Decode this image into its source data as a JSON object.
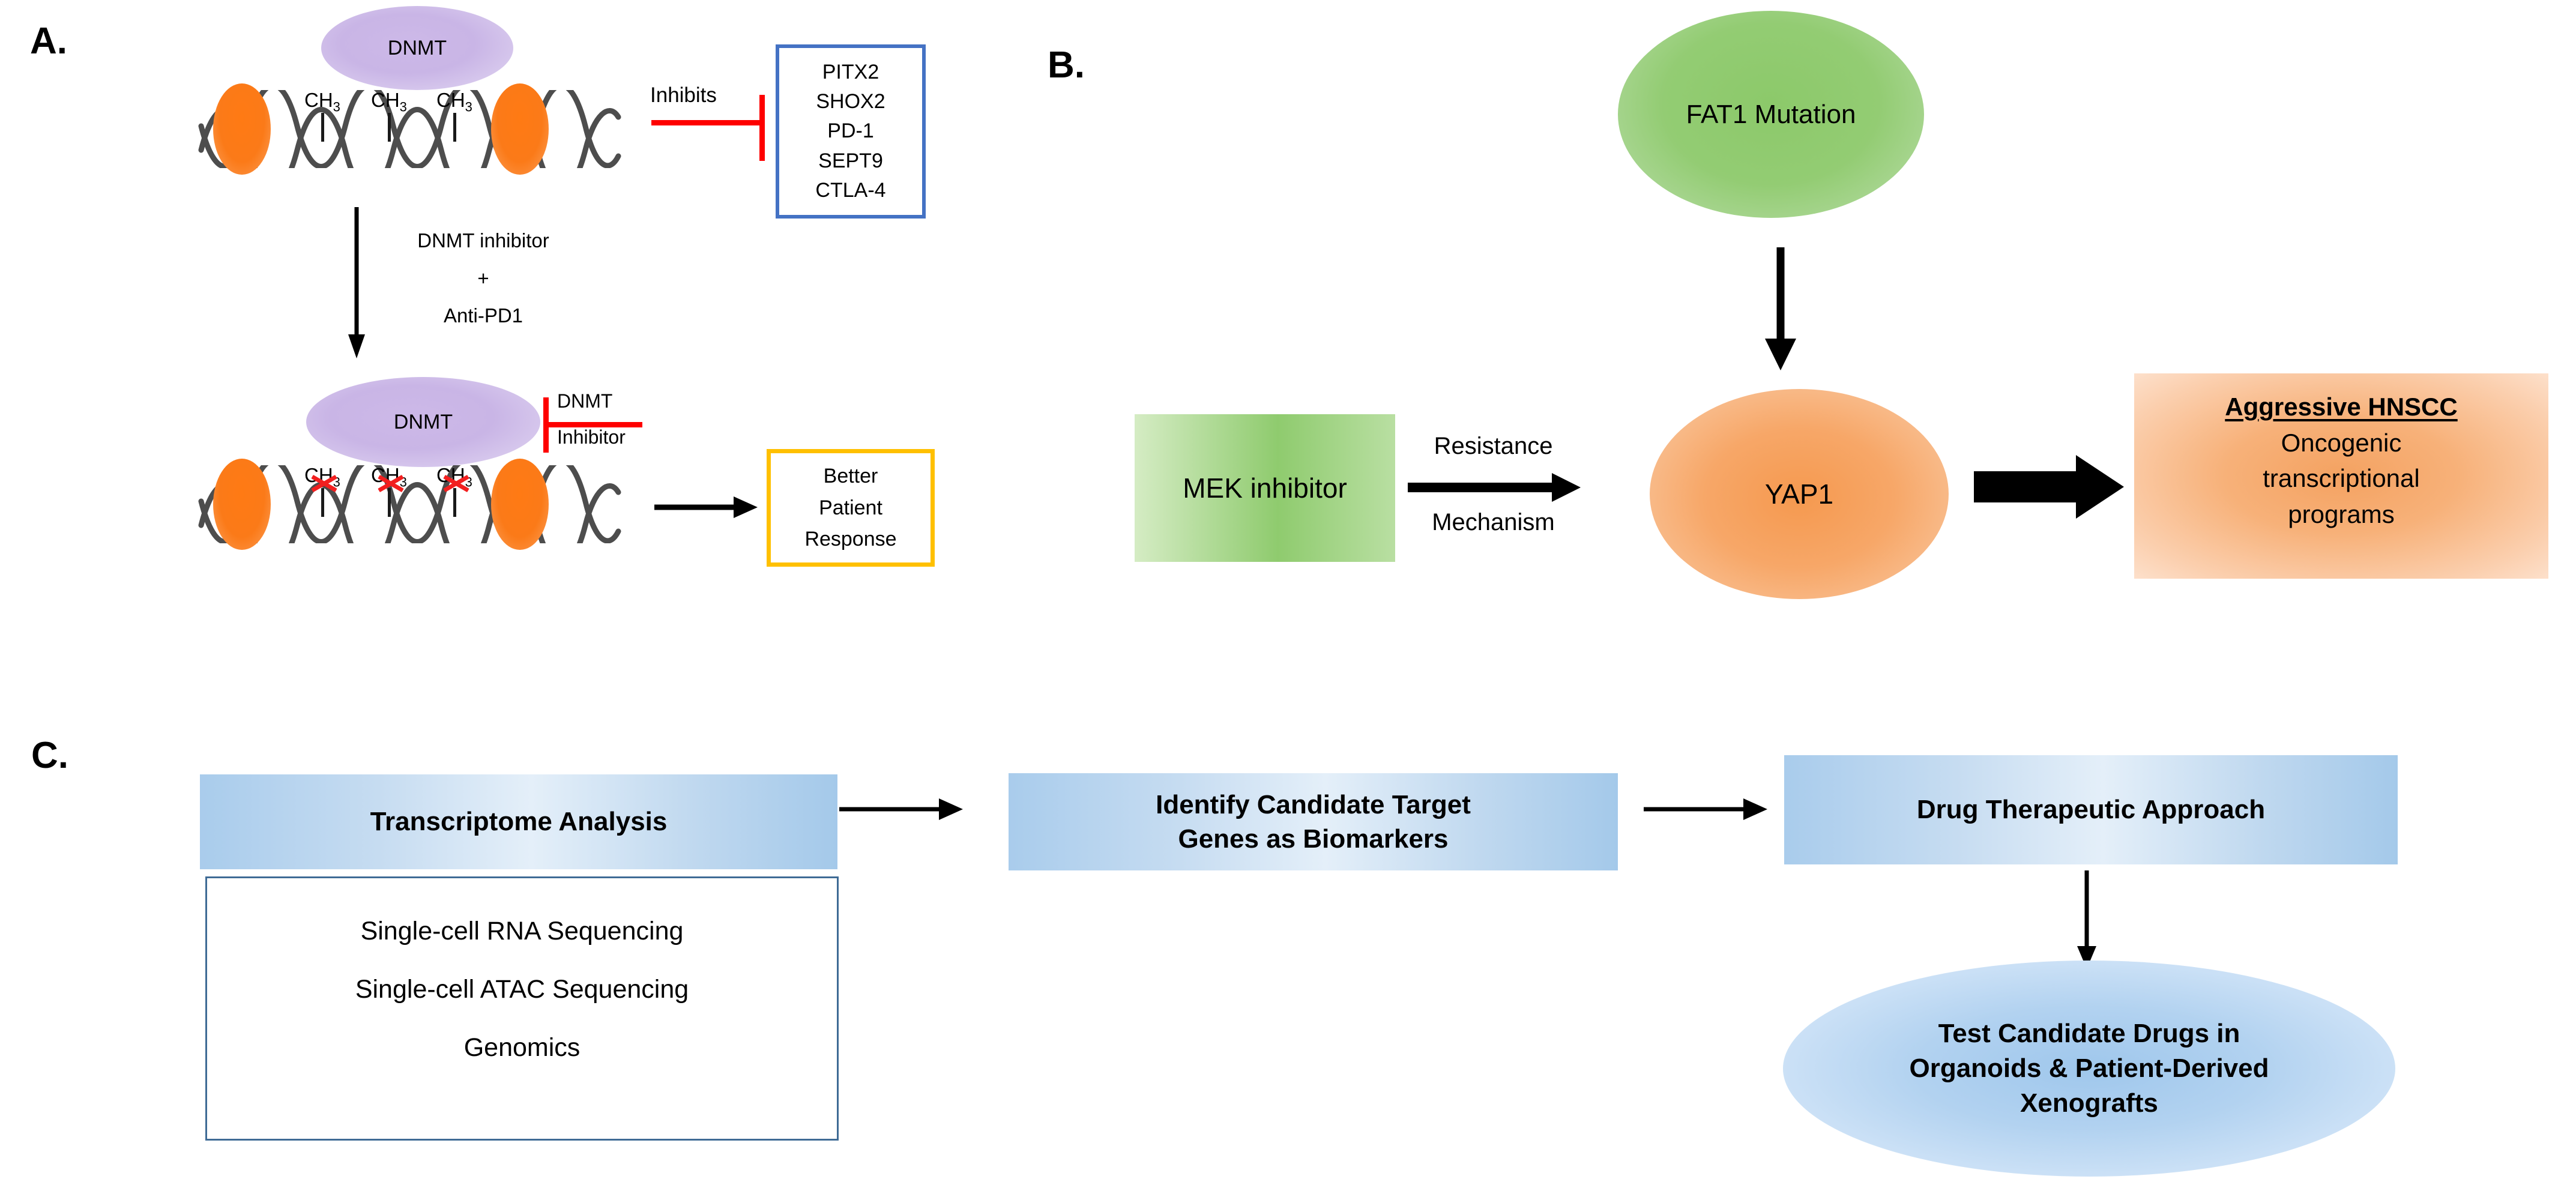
{
  "figure": {
    "panels": [
      {
        "id": "A",
        "letter": "A."
      },
      {
        "id": "B",
        "letter": "B."
      },
      {
        "id": "C",
        "letter": "C."
      }
    ]
  },
  "panel_a": {
    "letter": "A.",
    "top": {
      "enzyme_label": "DNMT",
      "methyl_groups": [
        "CH",
        "CH",
        "CH"
      ],
      "methyl_subscript": "3",
      "inhibits_label": "Inhibits",
      "gene_box": {
        "genes": [
          "PITX2",
          "SHOX2",
          "PD-1",
          "SEPT9",
          "CTLA-4"
        ],
        "border_color": "#4472C4"
      }
    },
    "treatment_arrow": {
      "line1": "DNMT inhibitor",
      "line2": "+",
      "line3": "Anti-PD1"
    },
    "bottom": {
      "enzyme_label": "DNMT",
      "inhibitor_label_top": "DNMT",
      "inhibitor_label_bottom": "Inhibitor",
      "inhibitor_color": "#FE0000",
      "methyl_groups": [
        "CH",
        "CH",
        "CH"
      ],
      "methyl_subscript": "3",
      "outcome_box": {
        "lines": [
          "Better",
          "Patient",
          "Response"
        ],
        "border_color": "#FFC000"
      }
    }
  },
  "panel_b": {
    "letter": "B.",
    "fat1_node": {
      "label": "FAT1 Mutation",
      "color": "#8CC96A"
    },
    "mek_node": {
      "label": "MEK inhibitor",
      "color": "#8FCB6E"
    },
    "resistance_label": {
      "line1": "Resistance",
      "line2": "Mechanism"
    },
    "yap1_node": {
      "label": "YAP1",
      "color": "#F5994F"
    },
    "outcome": {
      "title": "Aggressive HNSCC",
      "lines": [
        "Oncogenic",
        "transcriptional",
        "programs"
      ],
      "color": "#F4A261"
    }
  },
  "panel_c": {
    "letter": "C.",
    "step1": {
      "label": "Transcriptome Analysis"
    },
    "methods_box": {
      "items": [
        "Single-cell RNA Sequencing",
        "Single-cell ATAC Sequencing",
        "Genomics"
      ],
      "border_color": "#3F6B95"
    },
    "step2": {
      "line1": "Identify Candidate Target",
      "line2": "Genes as Biomarkers"
    },
    "step3": {
      "label": "Drug Therapeutic Approach"
    },
    "step4": {
      "line1": "Test Candidate Drugs in",
      "line2": "Organoids & Patient-Derived",
      "line3": "Xenografts"
    }
  }
}
